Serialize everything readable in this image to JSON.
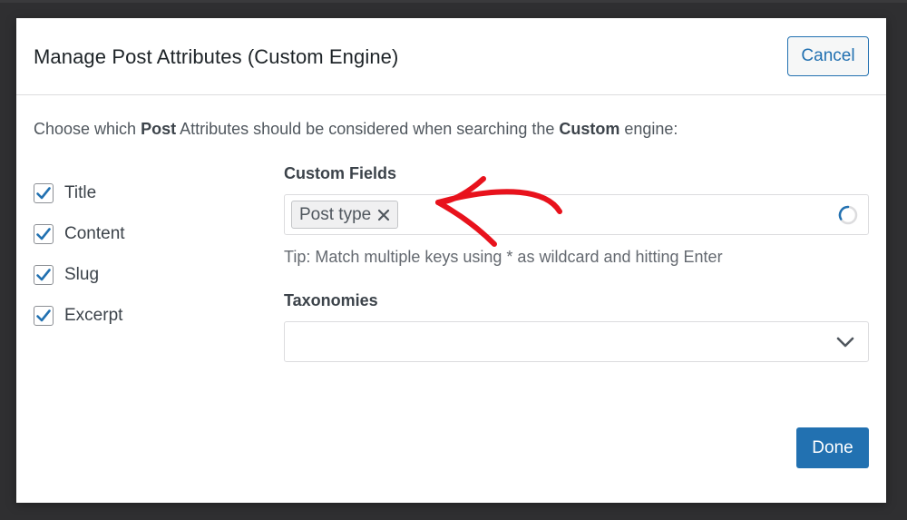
{
  "modal": {
    "title": "Manage Post Attributes (Custom Engine)",
    "cancel_label": "Cancel",
    "done_label": "Done"
  },
  "intro": {
    "prefix": "Choose which ",
    "bold1": "Post",
    "middle": " Attributes should be considered when searching the ",
    "bold2": "Custom",
    "suffix": " engine:"
  },
  "attributes": [
    {
      "label": "Title",
      "checked": true
    },
    {
      "label": "Content",
      "checked": true
    },
    {
      "label": "Slug",
      "checked": true
    },
    {
      "label": "Excerpt",
      "checked": true
    }
  ],
  "custom_fields": {
    "label": "Custom Fields",
    "tokens": [
      "Post type"
    ],
    "tip": "Tip: Match multiple keys using * as wildcard and hitting Enter"
  },
  "taxonomies": {
    "label": "Taxonomies",
    "value": ""
  },
  "colors": {
    "accent": "#2271b1",
    "annotation": "#e8121c"
  },
  "icons": {
    "check": "checkmark-icon",
    "remove": "close-icon",
    "loading": "spinner-icon",
    "dropdown": "chevron-down-icon",
    "annotation": "arrow-icon"
  }
}
